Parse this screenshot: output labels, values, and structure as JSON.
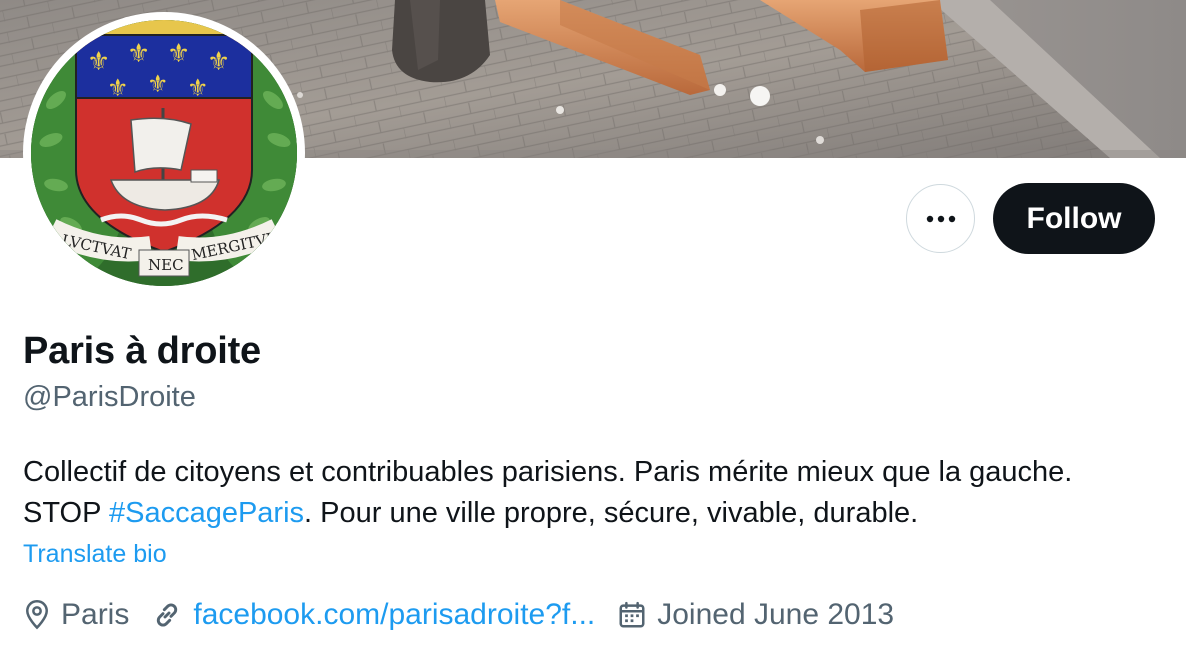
{
  "profile": {
    "display_name": "Paris à droite",
    "handle": "@ParisDroite",
    "bio_line1": "Collectif de citoyens et contribuables parisiens. Paris mérite mieux que la gauche.",
    "bio_line2_prefix": "STOP ",
    "bio_hashtag": "#SaccageParis",
    "bio_line2_suffix": ". Pour une ville propre, sécure, vivable, durable.",
    "translate_label": "Translate bio"
  },
  "actions": {
    "follow_label": "Follow",
    "more_icon": "more-horizontal-icon"
  },
  "meta": {
    "location": "Paris",
    "location_icon": "location-pin-icon",
    "website": "facebook.com/parisadroite?f...",
    "website_icon": "link-icon",
    "joined": "Joined June 2013",
    "joined_icon": "calendar-icon"
  },
  "avatar": {
    "motto_left": "LVCTVAT",
    "motto_center": "NEC",
    "motto_right": "MERGITVR"
  },
  "colors": {
    "accent_blue": "#1d9bf0",
    "text_primary": "#0f1419",
    "text_secondary": "#536471",
    "follow_bg": "#0f1419",
    "border": "#cfd9de"
  }
}
